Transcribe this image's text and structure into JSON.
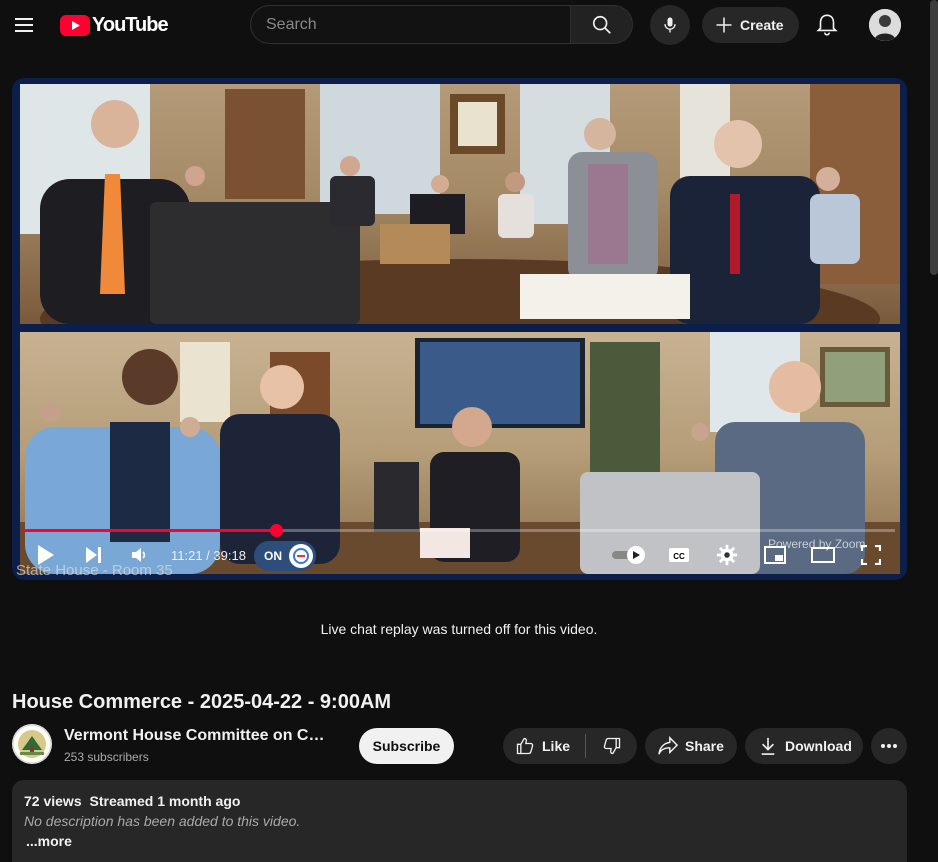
{
  "masthead": {
    "logo_text": "YouTube",
    "search": {
      "placeholder": "Search",
      "value": ""
    },
    "create_label": "Create",
    "icons": [
      "menu-icon",
      "youtube-logo-icon",
      "search-icon",
      "mic-icon",
      "plus-icon",
      "bell-icon"
    ]
  },
  "player": {
    "stamp_text": "State House - Room 35",
    "zoom_text": "Powered by Zoom",
    "time_current": "11:21",
    "time_total": "39:18",
    "time_display": "11:21 / 39:18",
    "progress_fraction": 0.289,
    "toggle_label": "ON",
    "colors": {
      "progress": "#ff0033",
      "frame": "#0b1f4a"
    }
  },
  "chat": {
    "message": "Live chat replay was turned off for this video."
  },
  "video": {
    "title": "House Commerce - 2025-04-22 - 9:00AM",
    "channel_name": "Vermont House Committee on Com...",
    "subscribers": "253 subscribers",
    "subscribe_label": "Subscribe",
    "like_label": "Like",
    "share_label": "Share",
    "download_label": "Download"
  },
  "description": {
    "views": "72 views",
    "streamed": "Streamed 1 month ago",
    "text": "No description has been added to this video.",
    "more_label": "...more"
  }
}
